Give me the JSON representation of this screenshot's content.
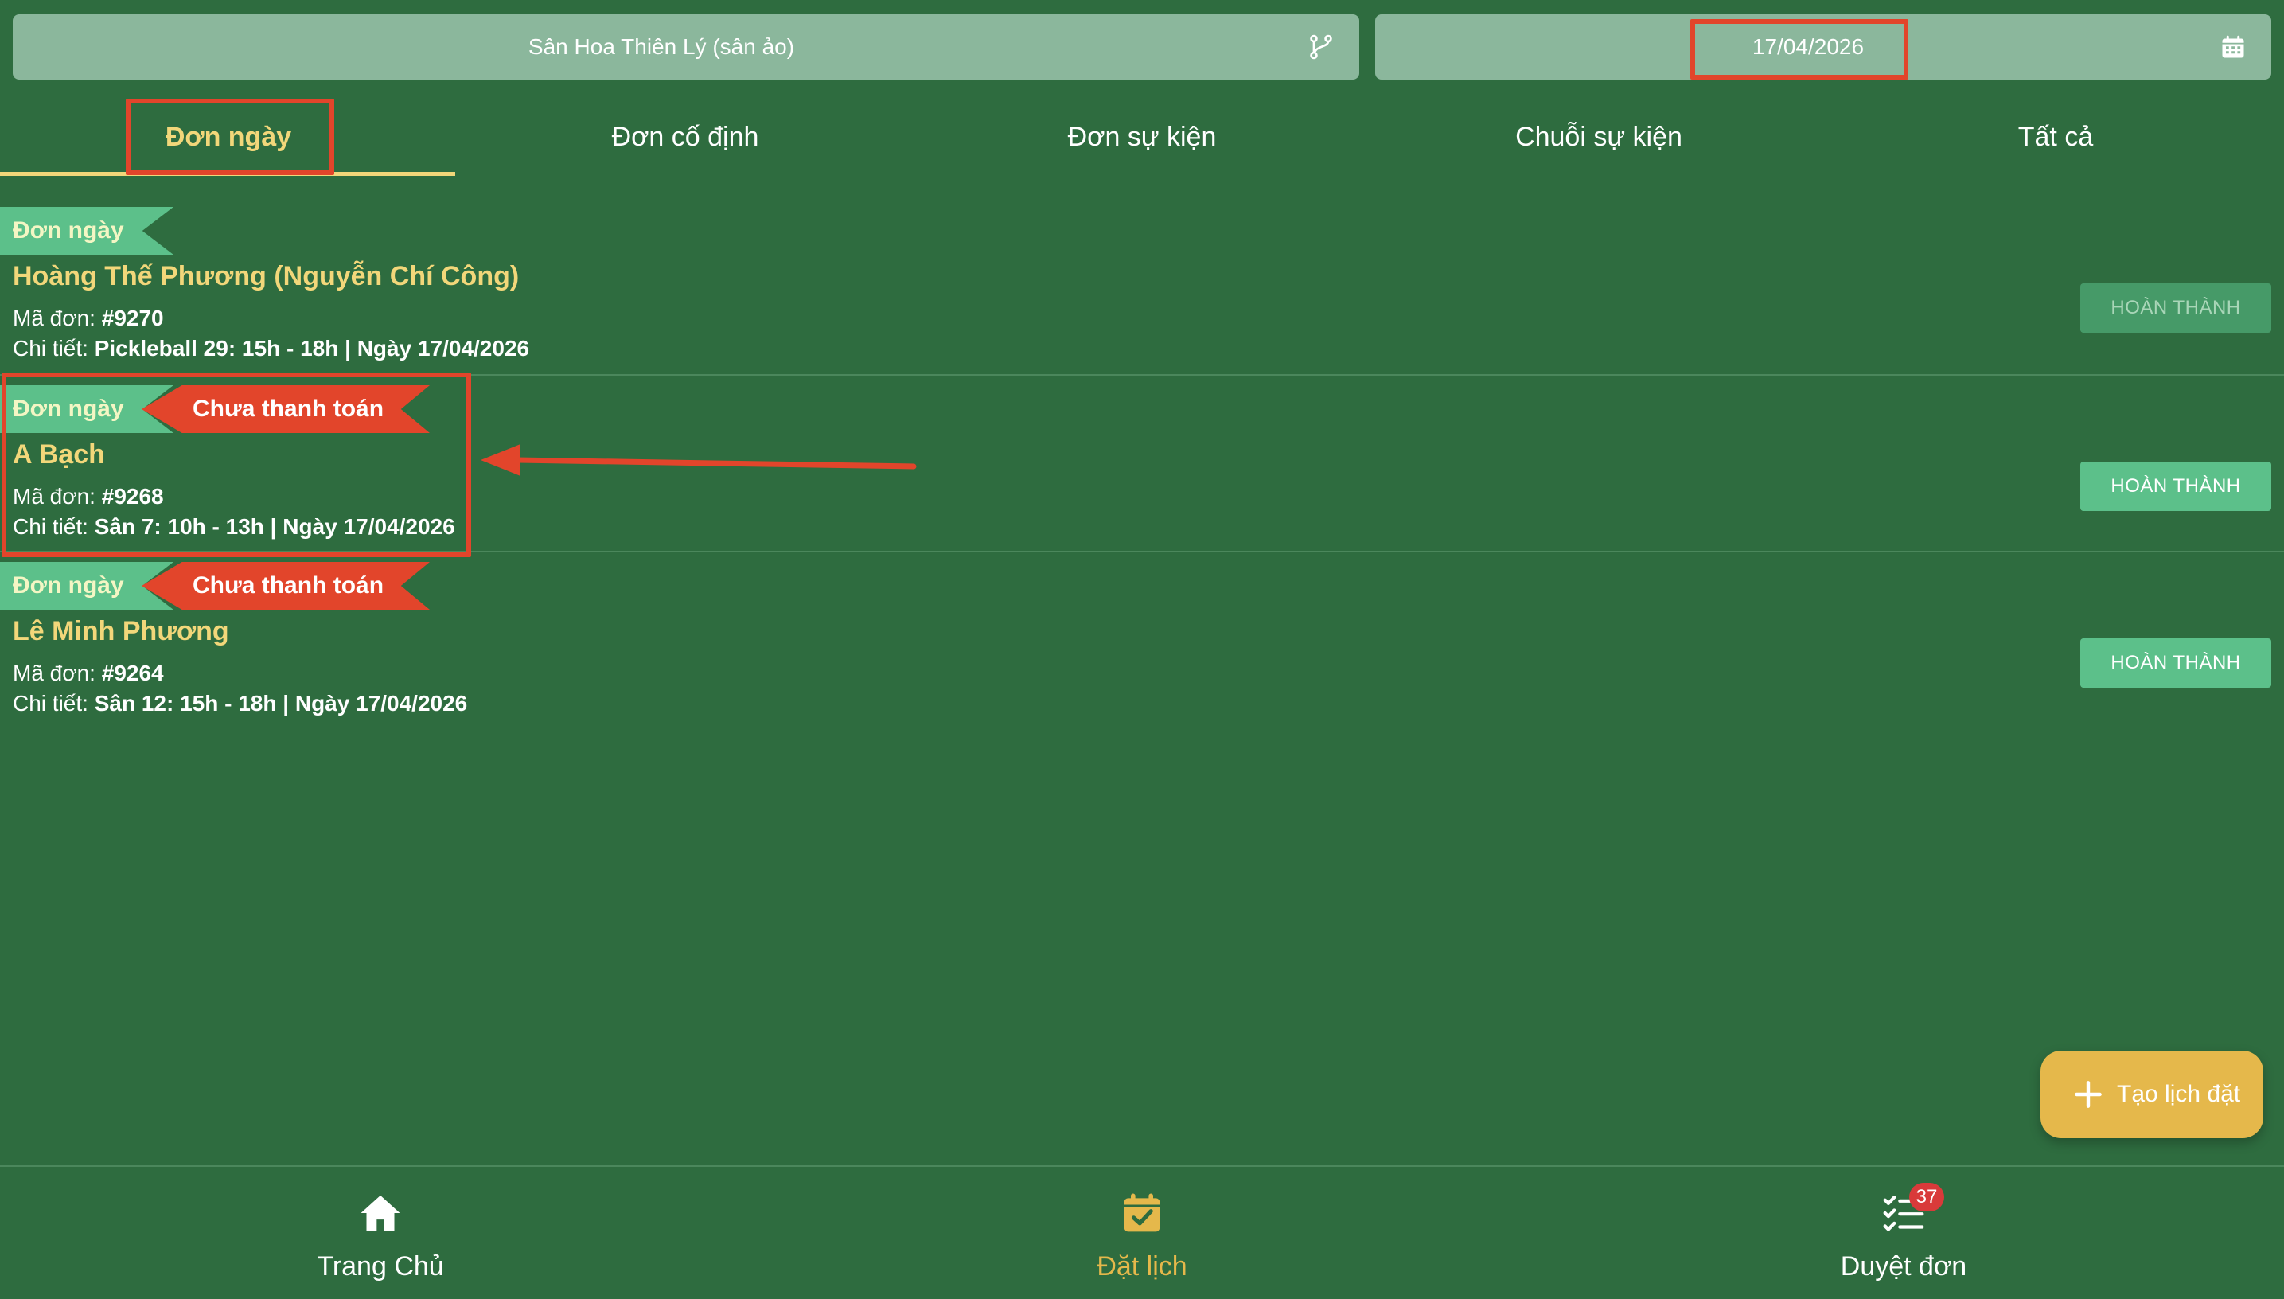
{
  "venue_selector": {
    "value": "Sân Hoa Thiên Lý (sân ảo)",
    "icon": "branch-icon"
  },
  "date_selector": {
    "value": "17/04/2026",
    "icon": "calendar-icon"
  },
  "tabs": [
    {
      "label": "Đơn ngày",
      "active": true
    },
    {
      "label": "Đơn cố định",
      "active": false
    },
    {
      "label": "Đơn sự kiện",
      "active": false
    },
    {
      "label": "Chuỗi sự kiện",
      "active": false
    },
    {
      "label": "Tất cả",
      "active": false
    }
  ],
  "orders": [
    {
      "type_badge": "Đơn ngày",
      "payment_badge": "",
      "customer": "Hoàng Thế Phương (Nguyễn Chí Công)",
      "code_label": "Mã đơn:",
      "code": "#9270",
      "detail_label": "Chi tiết:",
      "detail": "Pickleball 29: 15h - 18h | Ngày 17/04/2026",
      "action": "HOÀN THÀNH",
      "action_enabled": false
    },
    {
      "type_badge": "Đơn ngày",
      "payment_badge": "Chưa thanh toán",
      "customer": "A Bạch",
      "code_label": "Mã đơn:",
      "code": "#9268",
      "detail_label": "Chi tiết:",
      "detail": "Sân 7: 10h - 13h | Ngày 17/04/2026",
      "action": "HOÀN THÀNH",
      "action_enabled": true
    },
    {
      "type_badge": "Đơn ngày",
      "payment_badge": "Chưa thanh toán",
      "customer": "Lê Minh Phương",
      "code_label": "Mã đơn:",
      "code": "#9264",
      "detail_label": "Chi tiết:",
      "detail": "Sân 12: 15h - 18h | Ngày 17/04/2026",
      "action": "HOÀN THÀNH",
      "action_enabled": true
    }
  ],
  "fab": {
    "label": "Tạo lịch đặt",
    "icon": "plus-icon"
  },
  "bottom_nav": [
    {
      "label": "Trang Chủ",
      "icon": "home-icon",
      "active": false
    },
    {
      "label": "Đặt lịch",
      "icon": "calendar-check-icon",
      "active": true
    },
    {
      "label": "Duyệt đơn",
      "icon": "checklist-icon",
      "active": false,
      "badge": "37"
    }
  ],
  "colors": {
    "background": "#2e6c3f",
    "accent_yellow": "#f2d77a",
    "button_green": "#5cc08a",
    "unpaid_red": "#e2452b",
    "fab": "#e5b84b",
    "annotation_red": "#e2452b"
  }
}
